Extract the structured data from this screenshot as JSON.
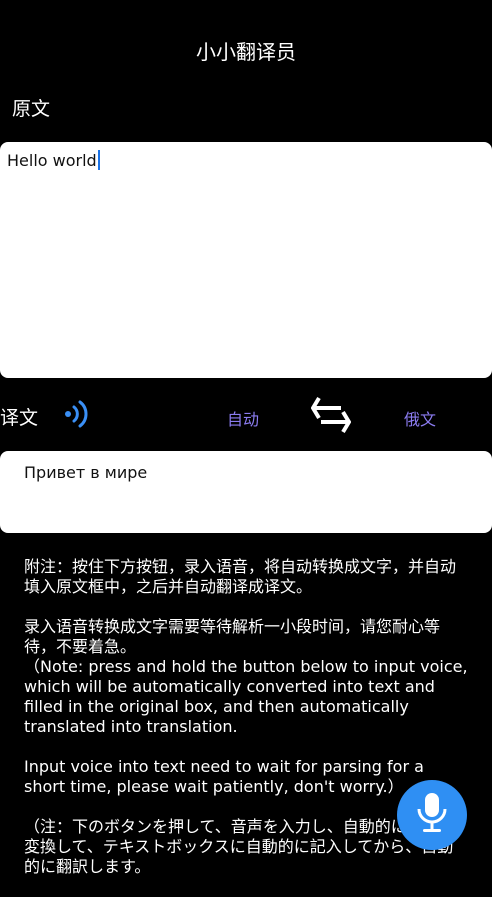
{
  "app": {
    "title": "小小翻译员"
  },
  "source": {
    "label": "原文",
    "text": "Hello world"
  },
  "translation": {
    "label": "译文",
    "from_lang": "自动",
    "to_lang": "俄文",
    "text": "Привет в мире"
  },
  "icons": {
    "speaker": "speaker-sound-icon",
    "swap": "swap-arrows-icon",
    "mic": "microphone-icon"
  },
  "colors": {
    "accent_lang": "#8b7cf0",
    "speaker": "#3a8ff5",
    "mic_button": "#2f8ff3"
  },
  "notes": [
    "附注：按住下方按钮，录入语音，将自动转换成文字，并自动填入原文框中，之后并自动翻译成译文。",
    "录入语音转换成文字需要等待解析一小段时间，请您耐心等待，不要着急。\n（Note: press and hold the button below to input voice, which will be automatically converted into text and filled in the original box, and then automatically translated into translation.",
    "Input voice into text need to wait for parsing for a short time, please wait patiently, don't worry.）",
    "（注：下のボタンを押して、音声を入力し、自動的に文字に変換して、テキストボックスに自動的に記入してから、自動的に翻訳します。"
  ]
}
